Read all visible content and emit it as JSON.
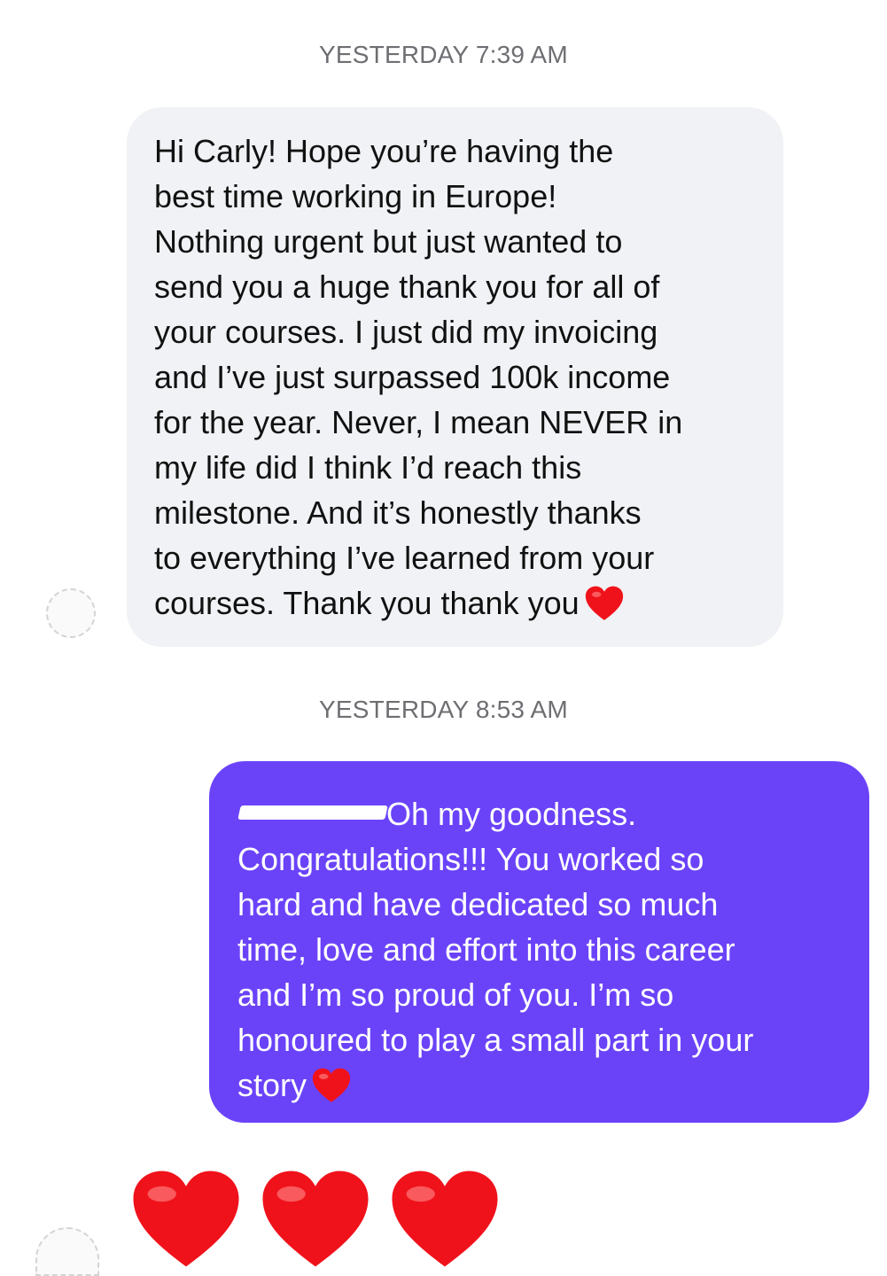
{
  "conversation": {
    "timestamps": [
      "YESTERDAY 7:39 AM",
      "YESTERDAY 8:53 AM"
    ],
    "incoming_message": {
      "lines": [
        "Hi Carly! Hope you’re having the",
        "best time working in Europe!",
        "Nothing urgent but just wanted to",
        "send you a huge thank you for all of",
        "your courses. I just did my invoicing",
        "and I’ve just surpassed 100k income",
        "for the year. Never, I mean NEVER in",
        "my life did I think I’d reach this",
        "milestone. And it’s honestly thanks",
        "to everything I’ve learned from your",
        "courses. Thank you thank you"
      ],
      "trailing_emoji": "red-heart-icon"
    },
    "outgoing_message": {
      "lines": [
        "Oh my goodness.",
        "Congratulations!!! You worked so",
        "hard and have dedicated so much",
        "time, love and effort into this career",
        "and I’m so proud of you. I’m so",
        "honoured to play a small part in your",
        "story"
      ],
      "trailing_emoji": "red-heart-icon"
    },
    "reaction_hearts": [
      "red-heart-icon",
      "red-heart-icon",
      "red-heart-icon"
    ]
  },
  "colors": {
    "incoming_bubble": "#f0f2f5",
    "outgoing_bubble": "#6a43f9",
    "heart": "#f0121b",
    "timestamp": "#6e6e73"
  }
}
